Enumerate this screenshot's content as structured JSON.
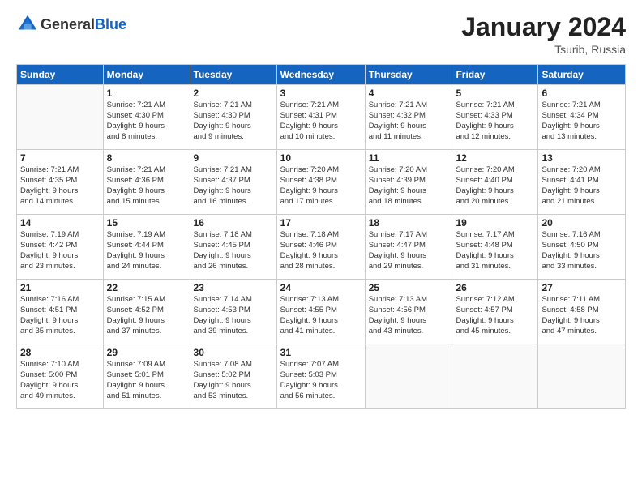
{
  "header": {
    "logo_general": "General",
    "logo_blue": "Blue",
    "main_title": "January 2024",
    "subtitle": "Tsurib, Russia"
  },
  "days_of_week": [
    "Sunday",
    "Monday",
    "Tuesday",
    "Wednesday",
    "Thursday",
    "Friday",
    "Saturday"
  ],
  "weeks": [
    {
      "shaded": false,
      "days": [
        {
          "num": "",
          "info": ""
        },
        {
          "num": "1",
          "info": "Sunrise: 7:21 AM\nSunset: 4:30 PM\nDaylight: 9 hours\nand 8 minutes."
        },
        {
          "num": "2",
          "info": "Sunrise: 7:21 AM\nSunset: 4:30 PM\nDaylight: 9 hours\nand 9 minutes."
        },
        {
          "num": "3",
          "info": "Sunrise: 7:21 AM\nSunset: 4:31 PM\nDaylight: 9 hours\nand 10 minutes."
        },
        {
          "num": "4",
          "info": "Sunrise: 7:21 AM\nSunset: 4:32 PM\nDaylight: 9 hours\nand 11 minutes."
        },
        {
          "num": "5",
          "info": "Sunrise: 7:21 AM\nSunset: 4:33 PM\nDaylight: 9 hours\nand 12 minutes."
        },
        {
          "num": "6",
          "info": "Sunrise: 7:21 AM\nSunset: 4:34 PM\nDaylight: 9 hours\nand 13 minutes."
        }
      ]
    },
    {
      "shaded": true,
      "days": [
        {
          "num": "7",
          "info": "Sunrise: 7:21 AM\nSunset: 4:35 PM\nDaylight: 9 hours\nand 14 minutes."
        },
        {
          "num": "8",
          "info": "Sunrise: 7:21 AM\nSunset: 4:36 PM\nDaylight: 9 hours\nand 15 minutes."
        },
        {
          "num": "9",
          "info": "Sunrise: 7:21 AM\nSunset: 4:37 PM\nDaylight: 9 hours\nand 16 minutes."
        },
        {
          "num": "10",
          "info": "Sunrise: 7:20 AM\nSunset: 4:38 PM\nDaylight: 9 hours\nand 17 minutes."
        },
        {
          "num": "11",
          "info": "Sunrise: 7:20 AM\nSunset: 4:39 PM\nDaylight: 9 hours\nand 18 minutes."
        },
        {
          "num": "12",
          "info": "Sunrise: 7:20 AM\nSunset: 4:40 PM\nDaylight: 9 hours\nand 20 minutes."
        },
        {
          "num": "13",
          "info": "Sunrise: 7:20 AM\nSunset: 4:41 PM\nDaylight: 9 hours\nand 21 minutes."
        }
      ]
    },
    {
      "shaded": false,
      "days": [
        {
          "num": "14",
          "info": "Sunrise: 7:19 AM\nSunset: 4:42 PM\nDaylight: 9 hours\nand 23 minutes."
        },
        {
          "num": "15",
          "info": "Sunrise: 7:19 AM\nSunset: 4:44 PM\nDaylight: 9 hours\nand 24 minutes."
        },
        {
          "num": "16",
          "info": "Sunrise: 7:18 AM\nSunset: 4:45 PM\nDaylight: 9 hours\nand 26 minutes."
        },
        {
          "num": "17",
          "info": "Sunrise: 7:18 AM\nSunset: 4:46 PM\nDaylight: 9 hours\nand 28 minutes."
        },
        {
          "num": "18",
          "info": "Sunrise: 7:17 AM\nSunset: 4:47 PM\nDaylight: 9 hours\nand 29 minutes."
        },
        {
          "num": "19",
          "info": "Sunrise: 7:17 AM\nSunset: 4:48 PM\nDaylight: 9 hours\nand 31 minutes."
        },
        {
          "num": "20",
          "info": "Sunrise: 7:16 AM\nSunset: 4:50 PM\nDaylight: 9 hours\nand 33 minutes."
        }
      ]
    },
    {
      "shaded": true,
      "days": [
        {
          "num": "21",
          "info": "Sunrise: 7:16 AM\nSunset: 4:51 PM\nDaylight: 9 hours\nand 35 minutes."
        },
        {
          "num": "22",
          "info": "Sunrise: 7:15 AM\nSunset: 4:52 PM\nDaylight: 9 hours\nand 37 minutes."
        },
        {
          "num": "23",
          "info": "Sunrise: 7:14 AM\nSunset: 4:53 PM\nDaylight: 9 hours\nand 39 minutes."
        },
        {
          "num": "24",
          "info": "Sunrise: 7:13 AM\nSunset: 4:55 PM\nDaylight: 9 hours\nand 41 minutes."
        },
        {
          "num": "25",
          "info": "Sunrise: 7:13 AM\nSunset: 4:56 PM\nDaylight: 9 hours\nand 43 minutes."
        },
        {
          "num": "26",
          "info": "Sunrise: 7:12 AM\nSunset: 4:57 PM\nDaylight: 9 hours\nand 45 minutes."
        },
        {
          "num": "27",
          "info": "Sunrise: 7:11 AM\nSunset: 4:58 PM\nDaylight: 9 hours\nand 47 minutes."
        }
      ]
    },
    {
      "shaded": false,
      "days": [
        {
          "num": "28",
          "info": "Sunrise: 7:10 AM\nSunset: 5:00 PM\nDaylight: 9 hours\nand 49 minutes."
        },
        {
          "num": "29",
          "info": "Sunrise: 7:09 AM\nSunset: 5:01 PM\nDaylight: 9 hours\nand 51 minutes."
        },
        {
          "num": "30",
          "info": "Sunrise: 7:08 AM\nSunset: 5:02 PM\nDaylight: 9 hours\nand 53 minutes."
        },
        {
          "num": "31",
          "info": "Sunrise: 7:07 AM\nSunset: 5:03 PM\nDaylight: 9 hours\nand 56 minutes."
        },
        {
          "num": "",
          "info": ""
        },
        {
          "num": "",
          "info": ""
        },
        {
          "num": "",
          "info": ""
        }
      ]
    }
  ]
}
